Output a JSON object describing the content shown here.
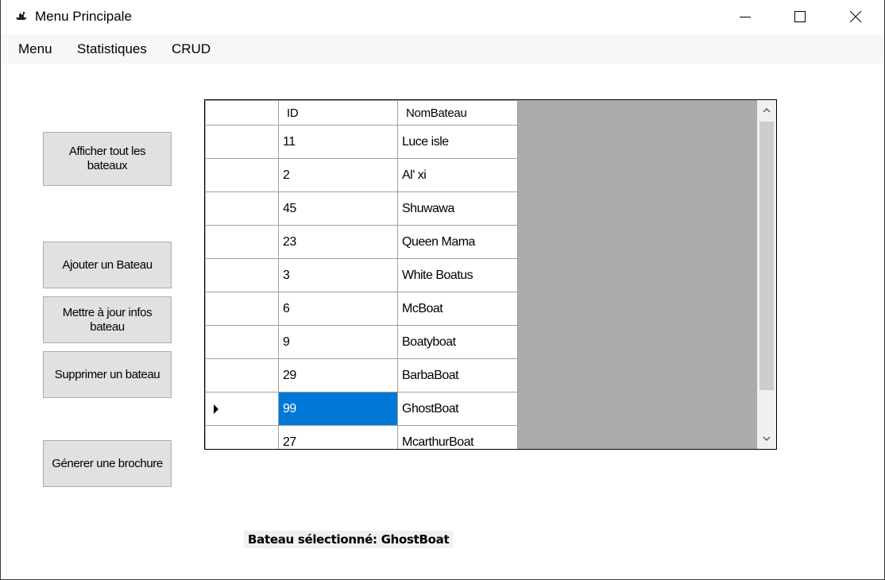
{
  "window": {
    "title": "Menu Principale",
    "icon": "boat-icon"
  },
  "menubar": {
    "items": [
      "Menu",
      "Statistiques",
      "CRUD"
    ]
  },
  "buttons": {
    "show_all": "Afficher tout les bateaux",
    "add": "Ajouter un Bateau",
    "update": "Mettre à jour infos bateau",
    "delete": "Supprimer un bateau",
    "brochure": "Génerer une brochure"
  },
  "grid": {
    "columns": [
      "ID",
      "NomBateau"
    ],
    "rows": [
      {
        "id": "11",
        "name": "Luce isle"
      },
      {
        "id": "2",
        "name": "Al' xi"
      },
      {
        "id": "45",
        "name": "Shuwawa"
      },
      {
        "id": "23",
        "name": "Queen Mama"
      },
      {
        "id": "3",
        "name": "White Boatus"
      },
      {
        "id": "6",
        "name": "McBoat"
      },
      {
        "id": "9",
        "name": "Boatyboat"
      },
      {
        "id": "29",
        "name": "BarbaBoat"
      },
      {
        "id": "99",
        "name": "GhostBoat"
      },
      {
        "id": "27",
        "name": "McarthurBoat"
      }
    ],
    "selected_row": 8,
    "selection_color": "#0078d7"
  },
  "status": {
    "selected_label": "Bateau sélectionné: GhostBoat"
  }
}
